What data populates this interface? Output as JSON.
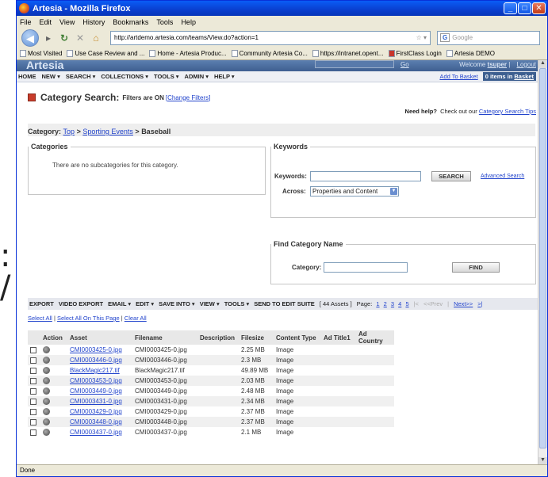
{
  "browser": {
    "title": "Artesia - Mozilla Firefox",
    "menu": [
      "File",
      "Edit",
      "View",
      "History",
      "Bookmarks",
      "Tools",
      "Help"
    ],
    "url": "http://artdemo.artesia.com/teams/View.do?action=1",
    "search_engine": "Google",
    "bookmarks": [
      "Most Visited",
      "Use Case Review and ...",
      "Home - Artesia Produc...",
      "Community Artesia Co...",
      "https://intranet.opent...",
      "FirstClass Login",
      "Artesia DEMO"
    ],
    "status": "Done"
  },
  "app": {
    "logo": "Artesia",
    "go_label": "Go",
    "welcome": "Welcome",
    "user": "tsuper",
    "logout": "Logout",
    "nav": [
      "HOME",
      "NEW ▾",
      "SEARCH ▾",
      "COLLECTIONS ▾",
      "TOOLS ▾",
      "ADMIN ▾",
      "HELP ▾"
    ],
    "add_to_basket": "Add To Basket",
    "basket_count": "0 items in",
    "basket_label": "Basket"
  },
  "page": {
    "title": "Category Search:",
    "filters": "Filters are ON",
    "change_filters": "[Change Filters]",
    "need_help": "Need help?",
    "help_text": "Check out our",
    "help_link": "Category Search Tips"
  },
  "breadcrumb": {
    "label": "Category:",
    "top": "Top",
    "sep": ">",
    "sporting": "Sporting Events",
    "current": "Baseball"
  },
  "categories": {
    "legend": "Categories",
    "empty": "There are no subcategories for this category."
  },
  "keywords": {
    "legend": "Keywords",
    "label": "Keywords:",
    "value": "",
    "search_btn": "SEARCH",
    "advanced": "Advanced Search",
    "across_label": "Across:",
    "across_value": "Properties and Content"
  },
  "find": {
    "legend": "Find Category Name",
    "label": "Category:",
    "value": "",
    "btn": "FIND"
  },
  "toolbar": {
    "items": [
      "EXPORT",
      "VIDEO EXPORT",
      "EMAIL ▾",
      "EDIT ▾",
      "SAVE INTO ▾",
      "VIEW ▾",
      "TOOLS ▾",
      "SEND TO EDIT SUITE"
    ],
    "count": "[ 44 Assets ]",
    "page_label": "Page:",
    "pages": [
      "1",
      "2",
      "3",
      "4",
      "5"
    ],
    "first": "|<",
    "prev": "<<Prev",
    "next": "Next>>",
    "last": ">|"
  },
  "select_links": {
    "all": "Select All",
    "page": "Select All On This Page",
    "clear": "Clear All"
  },
  "table": {
    "columns": [
      "",
      "Action",
      "Asset",
      "Filename",
      "Description",
      "Filesize",
      "Content Type",
      "Ad Title1",
      "Ad Country"
    ],
    "rows": [
      {
        "asset": "CMI0003425-0.jpg",
        "filename": "CMI0003425-0.jpg",
        "filesize": "2.25 MB",
        "type": "Image"
      },
      {
        "asset": "CMI0003446-0.jpg",
        "filename": "CMI0003446-0.jpg",
        "filesize": "2.3 MB",
        "type": "Image"
      },
      {
        "asset": "BlackMagic217.tif",
        "filename": "BlackMagic217.tif",
        "filesize": "49.89 MB",
        "type": "Image"
      },
      {
        "asset": "CMI0003453-0.jpg",
        "filename": "CMI0003453-0.jpg",
        "filesize": "2.03 MB",
        "type": "Image"
      },
      {
        "asset": "CMI0003449-0.jpg",
        "filename": "CMI0003449-0.jpg",
        "filesize": "2.48 MB",
        "type": "Image"
      },
      {
        "asset": "CMI0003431-0.jpg",
        "filename": "CMI0003431-0.jpg",
        "filesize": "2.34 MB",
        "type": "Image"
      },
      {
        "asset": "CMI0003429-0.jpg",
        "filename": "CMI0003429-0.jpg",
        "filesize": "2.37 MB",
        "type": "Image"
      },
      {
        "asset": "CMI0003448-0.jpg",
        "filename": "CMI0003448-0.jpg",
        "filesize": "2.37 MB",
        "type": "Image"
      },
      {
        "asset": "CMI0003437-0.jpg",
        "filename": "CMI0003437-0.jpg",
        "filesize": "2.1 MB",
        "type": "Image"
      }
    ]
  }
}
